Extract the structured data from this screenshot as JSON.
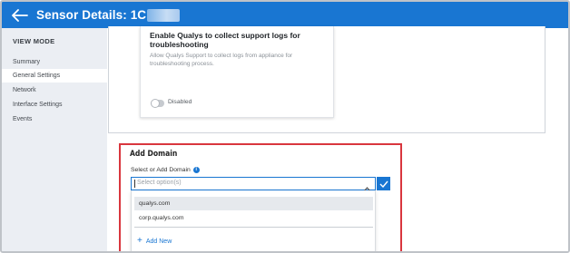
{
  "header": {
    "title": "Sensor Details:",
    "id_visible": "1C"
  },
  "sidebar": {
    "heading": "VIEW MODE",
    "items": [
      {
        "label": "Summary",
        "active": false
      },
      {
        "label": "General Settings",
        "active": true
      },
      {
        "label": "Network",
        "active": false
      },
      {
        "label": "Interface Settings",
        "active": false
      },
      {
        "label": "Events",
        "active": false
      }
    ]
  },
  "support_logs_card": {
    "title": "Enable Qualys to collect support logs for troubleshooting",
    "description": "Allow Qualys Support to collect logs from appliance for troubleshooting process.",
    "toggle_state": "Disabled"
  },
  "add_domain": {
    "title": "Add Domain",
    "field_label": "Select or Add Domain",
    "placeholder": "Select option(s)",
    "options": [
      "qualys.com",
      "corp.qualys.com"
    ],
    "add_new_label": "Add New"
  },
  "colors": {
    "primary": "#1976d2",
    "highlight": "#d9363e",
    "sidebar_bg": "#ebeef3"
  }
}
